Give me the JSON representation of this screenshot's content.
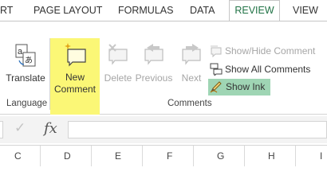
{
  "tabs": [
    {
      "label": "RT"
    },
    {
      "label": "PAGE LAYOUT"
    },
    {
      "label": "FORMULAS"
    },
    {
      "label": "DATA"
    },
    {
      "label": "REVIEW"
    },
    {
      "label": "VIEW"
    }
  ],
  "ribbon": {
    "translate_label": "Translate",
    "new_comment_line1": "New",
    "new_comment_line2": "Comment",
    "delete_label": "Delete",
    "previous_label": "Previous",
    "next_label": "Next",
    "show_hide_comment": "Show/Hide Comment",
    "show_all_comments": "Show All Comments",
    "show_ink": "Show Ink",
    "group_language": "Language",
    "group_comments": "Comments"
  },
  "formula_bar": {
    "fx_label": "fx",
    "check_symbol": "✓",
    "value": ""
  },
  "columns": [
    "C",
    "D",
    "E",
    "F",
    "G",
    "H",
    "I"
  ],
  "colors": {
    "accent": "#217346",
    "highlight": "#fbf776",
    "show_ink_bg": "#9fd5b4"
  }
}
